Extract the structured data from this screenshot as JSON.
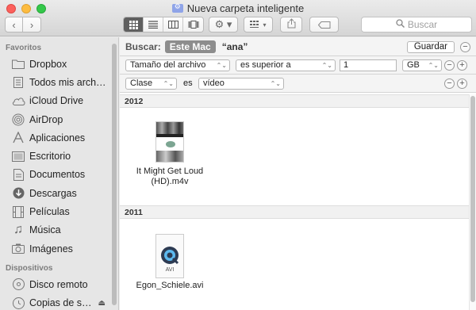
{
  "window": {
    "title": "Nueva carpeta inteligente"
  },
  "toolbar": {
    "back_icon": "chevron-left-icon",
    "forward_icon": "chevron-right-icon",
    "view_modes": [
      "icon-view-icon",
      "list-view-icon",
      "column-view-icon",
      "coverflow-view-icon"
    ],
    "active_view": "icon-view-icon",
    "action_icon": "gear-icon",
    "arrange_icon": "arrange-icon",
    "share_icon": "share-icon",
    "tag_icon": "tag-icon",
    "search_placeholder": "Buscar"
  },
  "sidebar": {
    "favorites_header": "Favoritos",
    "favorites": [
      {
        "label": "Dropbox",
        "icon": "folder-icon"
      },
      {
        "label": "Todos mis arch…",
        "icon": "all-files-icon"
      },
      {
        "label": "iCloud Drive",
        "icon": "cloud-icon"
      },
      {
        "label": "AirDrop",
        "icon": "airdrop-icon"
      },
      {
        "label": "Aplicaciones",
        "icon": "applications-icon"
      },
      {
        "label": "Escritorio",
        "icon": "desktop-icon"
      },
      {
        "label": "Documentos",
        "icon": "documents-icon"
      },
      {
        "label": "Descargas",
        "icon": "downloads-icon"
      },
      {
        "label": "Películas",
        "icon": "movies-icon"
      },
      {
        "label": "Música",
        "icon": "music-icon"
      },
      {
        "label": "Imágenes",
        "icon": "pictures-icon"
      }
    ],
    "devices_header": "Dispositivos",
    "devices": [
      {
        "label": "Disco remoto",
        "icon": "remote-disc-icon"
      },
      {
        "label": "Copias de s…",
        "icon": "backup-disk-icon"
      }
    ]
  },
  "searchbar": {
    "label": "Buscar:",
    "scope_selected": "Este Mac",
    "scope_query": "“ana”",
    "save_label": "Guardar"
  },
  "rules": [
    {
      "attribute": "Tamaño del archivo",
      "operator": "es superior a",
      "value": "1",
      "unit": "GB"
    },
    {
      "attribute": "Clase",
      "operator": "es",
      "value": "vídeo"
    }
  ],
  "results": {
    "groups": [
      {
        "year": "2012",
        "files": [
          {
            "name": "It Might Get Loud (HD).m4v",
            "name_line1": "It Might Get Loud",
            "name_line2": "(HD).m4v",
            "icon": "video-thumbnail-icon"
          }
        ]
      },
      {
        "year": "2011",
        "files": [
          {
            "name": "Egon_Schiele.avi",
            "icon": "quicktime-avi-icon",
            "badge": "AVI"
          }
        ]
      }
    ]
  }
}
